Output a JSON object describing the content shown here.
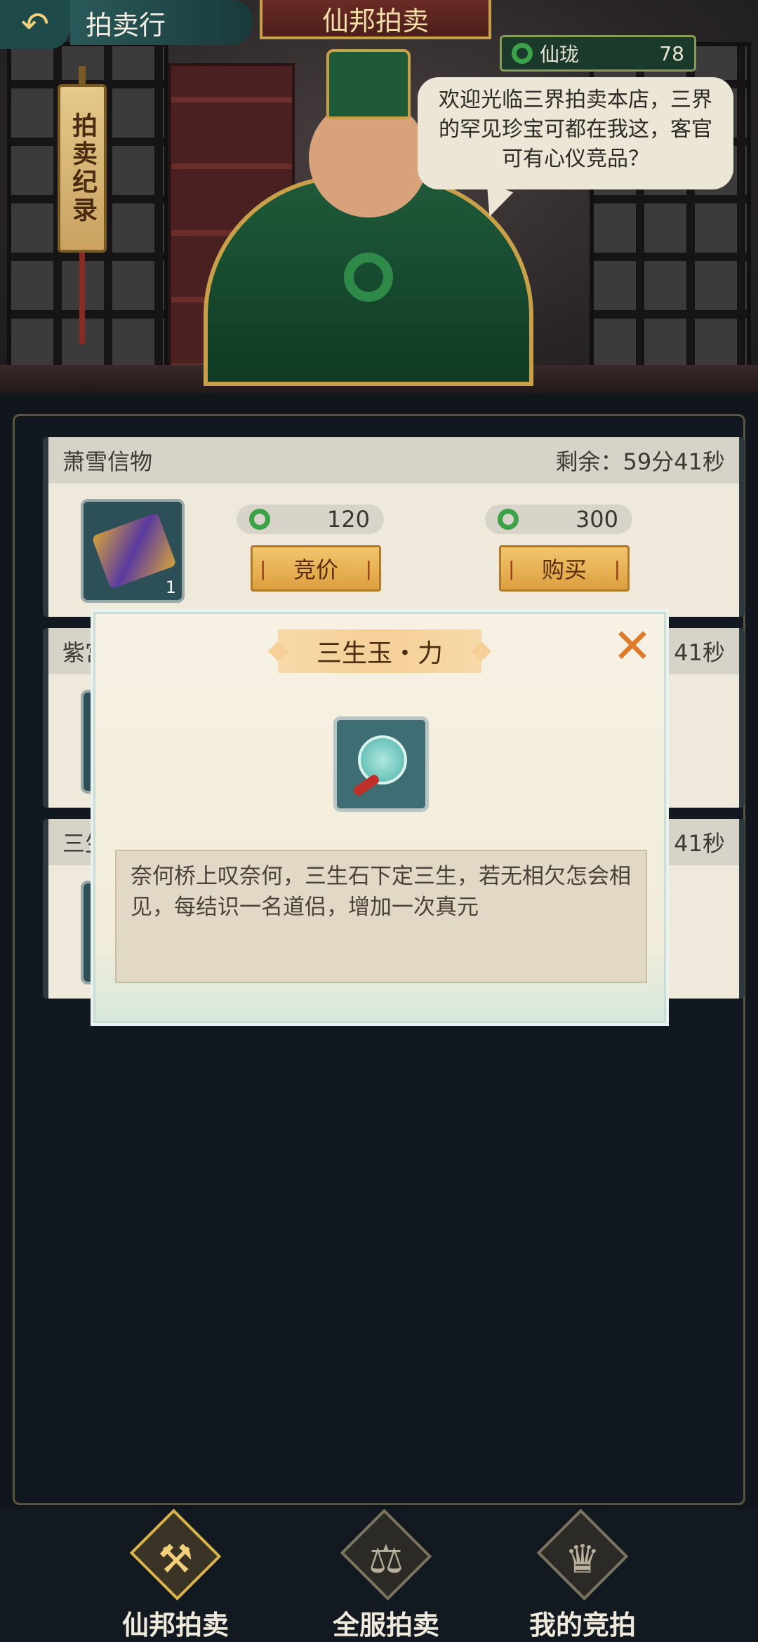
{
  "header": {
    "back_glyph": "↶",
    "page_title": "拍卖行",
    "banner_title": "仙邦拍卖",
    "currency": {
      "icon": "jade-ring-icon",
      "name": "仙珑",
      "value": "78"
    },
    "record_label": "拍卖纪录"
  },
  "merchant": {
    "speech": "欢迎光临三界拍卖本店，三界的罕见珍宝可都在我这，客官可有心仪竞品？"
  },
  "items": [
    {
      "name": "萧雪信物",
      "remaining": "剩余：59分41秒",
      "quantity": "1",
      "bid_price": "120",
      "buy_price": "300",
      "bid_label": "竞价",
      "buy_label": "购买"
    },
    {
      "name": "紫宫",
      "remaining_tail": "41秒"
    },
    {
      "name": "三生",
      "remaining_tail": "41秒"
    }
  ],
  "modal": {
    "title": "三生玉・力",
    "close_glyph": "✕",
    "description": "奈何桥上叹奈何，三生石下定三生，若无相欠怎会相见，每结识一名道侣，增加一次真元"
  },
  "nav": [
    {
      "label": "仙邦拍卖",
      "icon": "gavel-icon",
      "glyph": "⚒",
      "active": true
    },
    {
      "label": "全服拍卖",
      "icon": "scales-icon",
      "glyph": "⚖",
      "active": false
    },
    {
      "label": "我的竞拍",
      "icon": "bid-icon",
      "glyph": "♛",
      "active": false
    }
  ],
  "colors": {
    "accent_gold": "#f2c66d",
    "jade_green": "#3ba24a",
    "panel_bg": "#111820",
    "close_orange": "#e07a2a"
  }
}
